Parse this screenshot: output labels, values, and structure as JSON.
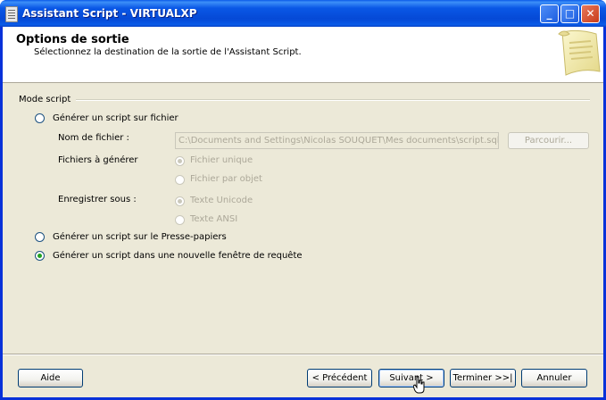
{
  "window": {
    "title": "Assistant Script - VIRTUALXP",
    "controls": {
      "minimize": "_",
      "maximize": "□",
      "close": "✕"
    }
  },
  "header": {
    "title": "Options de sortie",
    "subtitle": "Sélectionnez la destination de la sortie de l'Assistant Script."
  },
  "mode_group": {
    "label": "Mode script",
    "option_file": {
      "label": "Générer un script sur fichier",
      "checked": false
    },
    "filename_label": "Nom de fichier :",
    "filename_value": "C:\\Documents and Settings\\Nicolas SOUQUET\\Mes documents\\script.sql",
    "browse_label": "Parcourir...",
    "files_label": "Fichiers à générer",
    "file_single": "Fichier unique",
    "file_per_object": "Fichier par objet",
    "save_as_label": "Enregistrer sous :",
    "unicode_text": "Texte Unicode",
    "ansi_text": "Texte ANSI",
    "option_clipboard": {
      "label": "Générer un script sur le Presse-papiers",
      "checked": false
    },
    "option_query_window": {
      "label": "Générer un script dans une nouvelle fenêtre de requête",
      "checked": true
    }
  },
  "buttons": {
    "help": "Aide",
    "previous": "< Précédent",
    "next": "Suivant >",
    "finish": "Terminer >>|",
    "cancel": "Annuler"
  },
  "colors": {
    "titlebar": "#0a58e6",
    "dialog_bg": "#ece9d8",
    "radio_checked": "#21a121"
  },
  "icons": {
    "title": "script-document-icon",
    "header": "scroll-icon",
    "cursor": "hand-pointer-cursor"
  }
}
